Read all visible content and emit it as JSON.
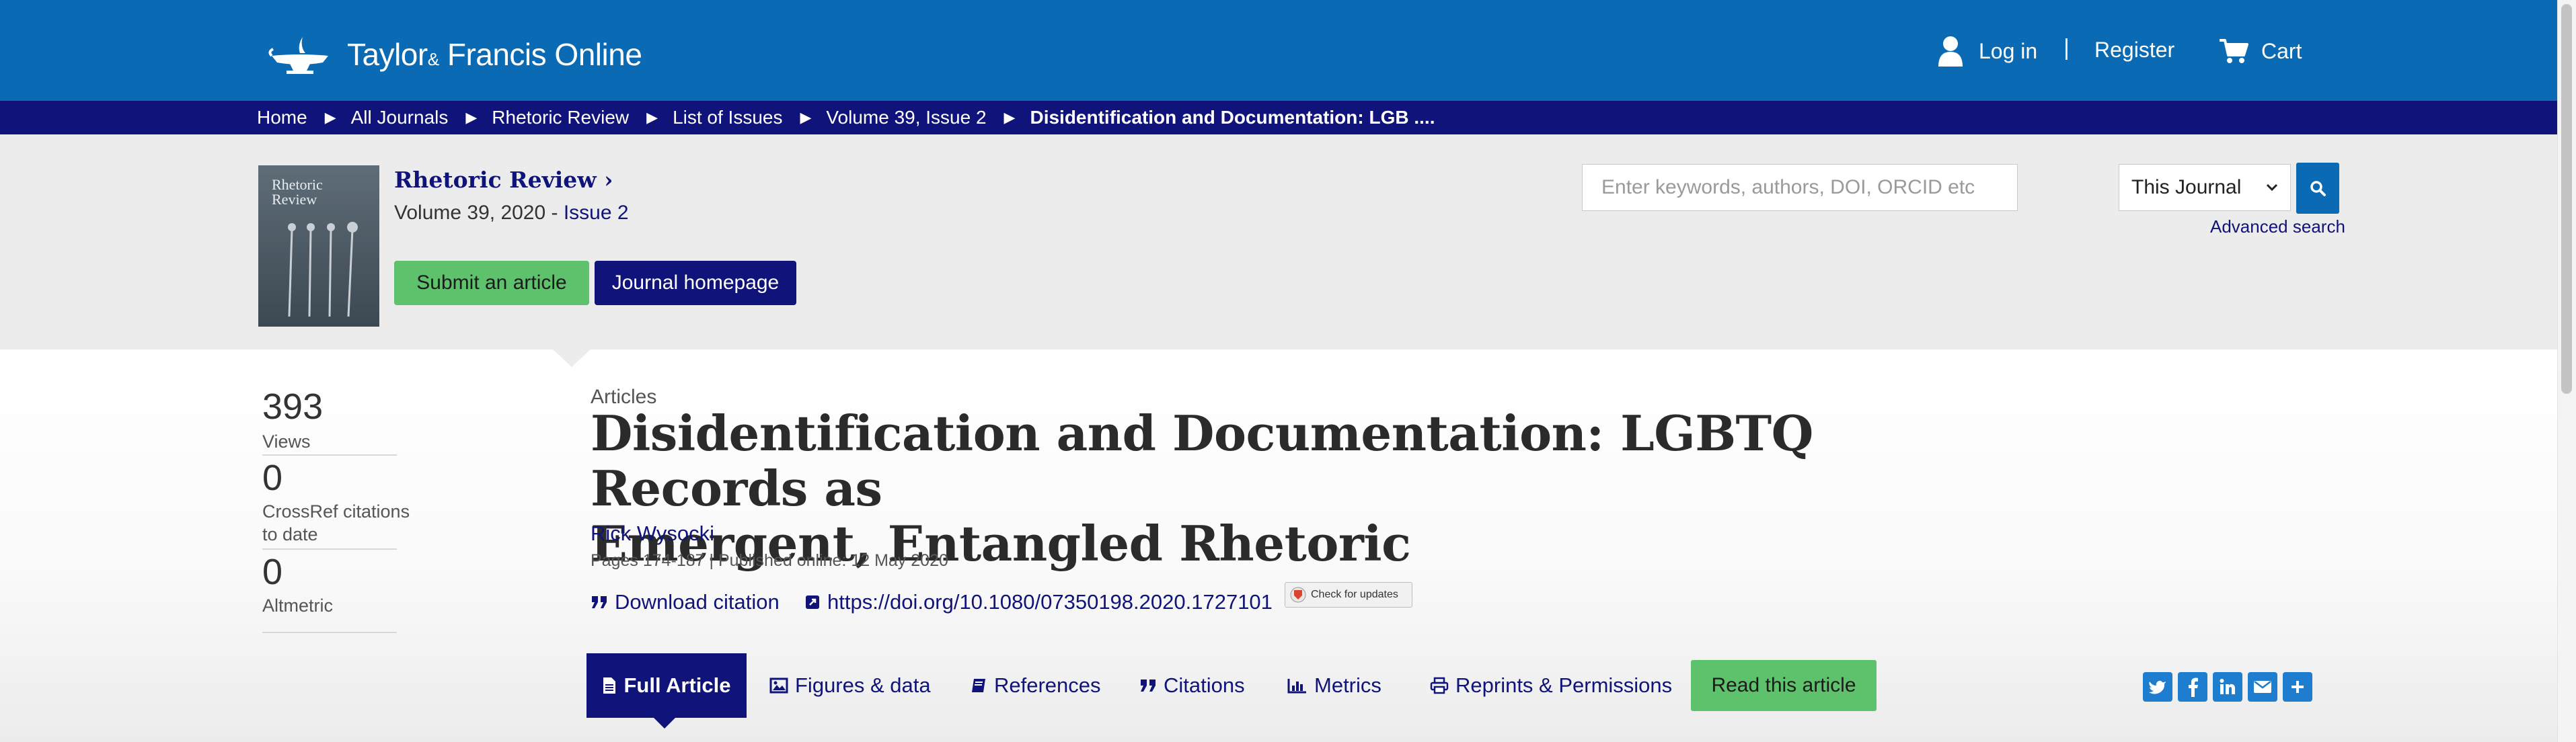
{
  "header": {
    "brand_main": "Taylor",
    "brand_amp": "&",
    "brand_rest": "Francis Online",
    "login": "Log in",
    "separator": "|",
    "register": "Register",
    "cart": "Cart"
  },
  "breadcrumbs": [
    "Home",
    "All Journals",
    "Rhetoric Review",
    "List of Issues",
    "Volume 39, Issue 2",
    "Disidentification and Documentation: LGB ...."
  ],
  "journal": {
    "cover_title": "Rhetoric Review",
    "name": "Rhetoric Review ›",
    "volume_text": "Volume 39, 2020 - ",
    "issue_link": "Issue 2",
    "submit_label": "Submit an article",
    "homepage_label": "Journal homepage"
  },
  "search": {
    "placeholder": "Enter keywords, authors, DOI, ORCID etc",
    "scope_value": "This Journal",
    "advanced": "Advanced search"
  },
  "metrics": [
    {
      "value": "393",
      "label": "Views"
    },
    {
      "value": "0",
      "label": "CrossRef citations to date"
    },
    {
      "value": "0",
      "label": "Altmetric"
    }
  ],
  "article": {
    "section": "Articles",
    "title_line1": "Disidentification and Documentation: LGBTQ Records as",
    "title_line2": "Emergent, Entangled Rhetoric",
    "author": "Rick Wysocki",
    "pages_info": "Pages 174-187 | Published online: 12 May 2020",
    "download_citation": "Download citation",
    "doi": "https://doi.org/10.1080/07350198.2020.1727101",
    "check_updates": "Check for updates"
  },
  "tabs": {
    "full_article": "Full Article",
    "figures": "Figures & data",
    "references": "References",
    "citations": "Citations",
    "metrics": "Metrics",
    "reprints": "Reprints & Permissions",
    "read": "Read this article"
  },
  "share": {
    "icons": [
      "twitter-icon",
      "facebook-icon",
      "linkedin-icon",
      "email-icon",
      "plus-icon"
    ]
  },
  "colors": {
    "header_blue": "#0a6ab3",
    "navy": "#10147a",
    "green": "#5ec16c",
    "banner_gray": "#ececec"
  }
}
